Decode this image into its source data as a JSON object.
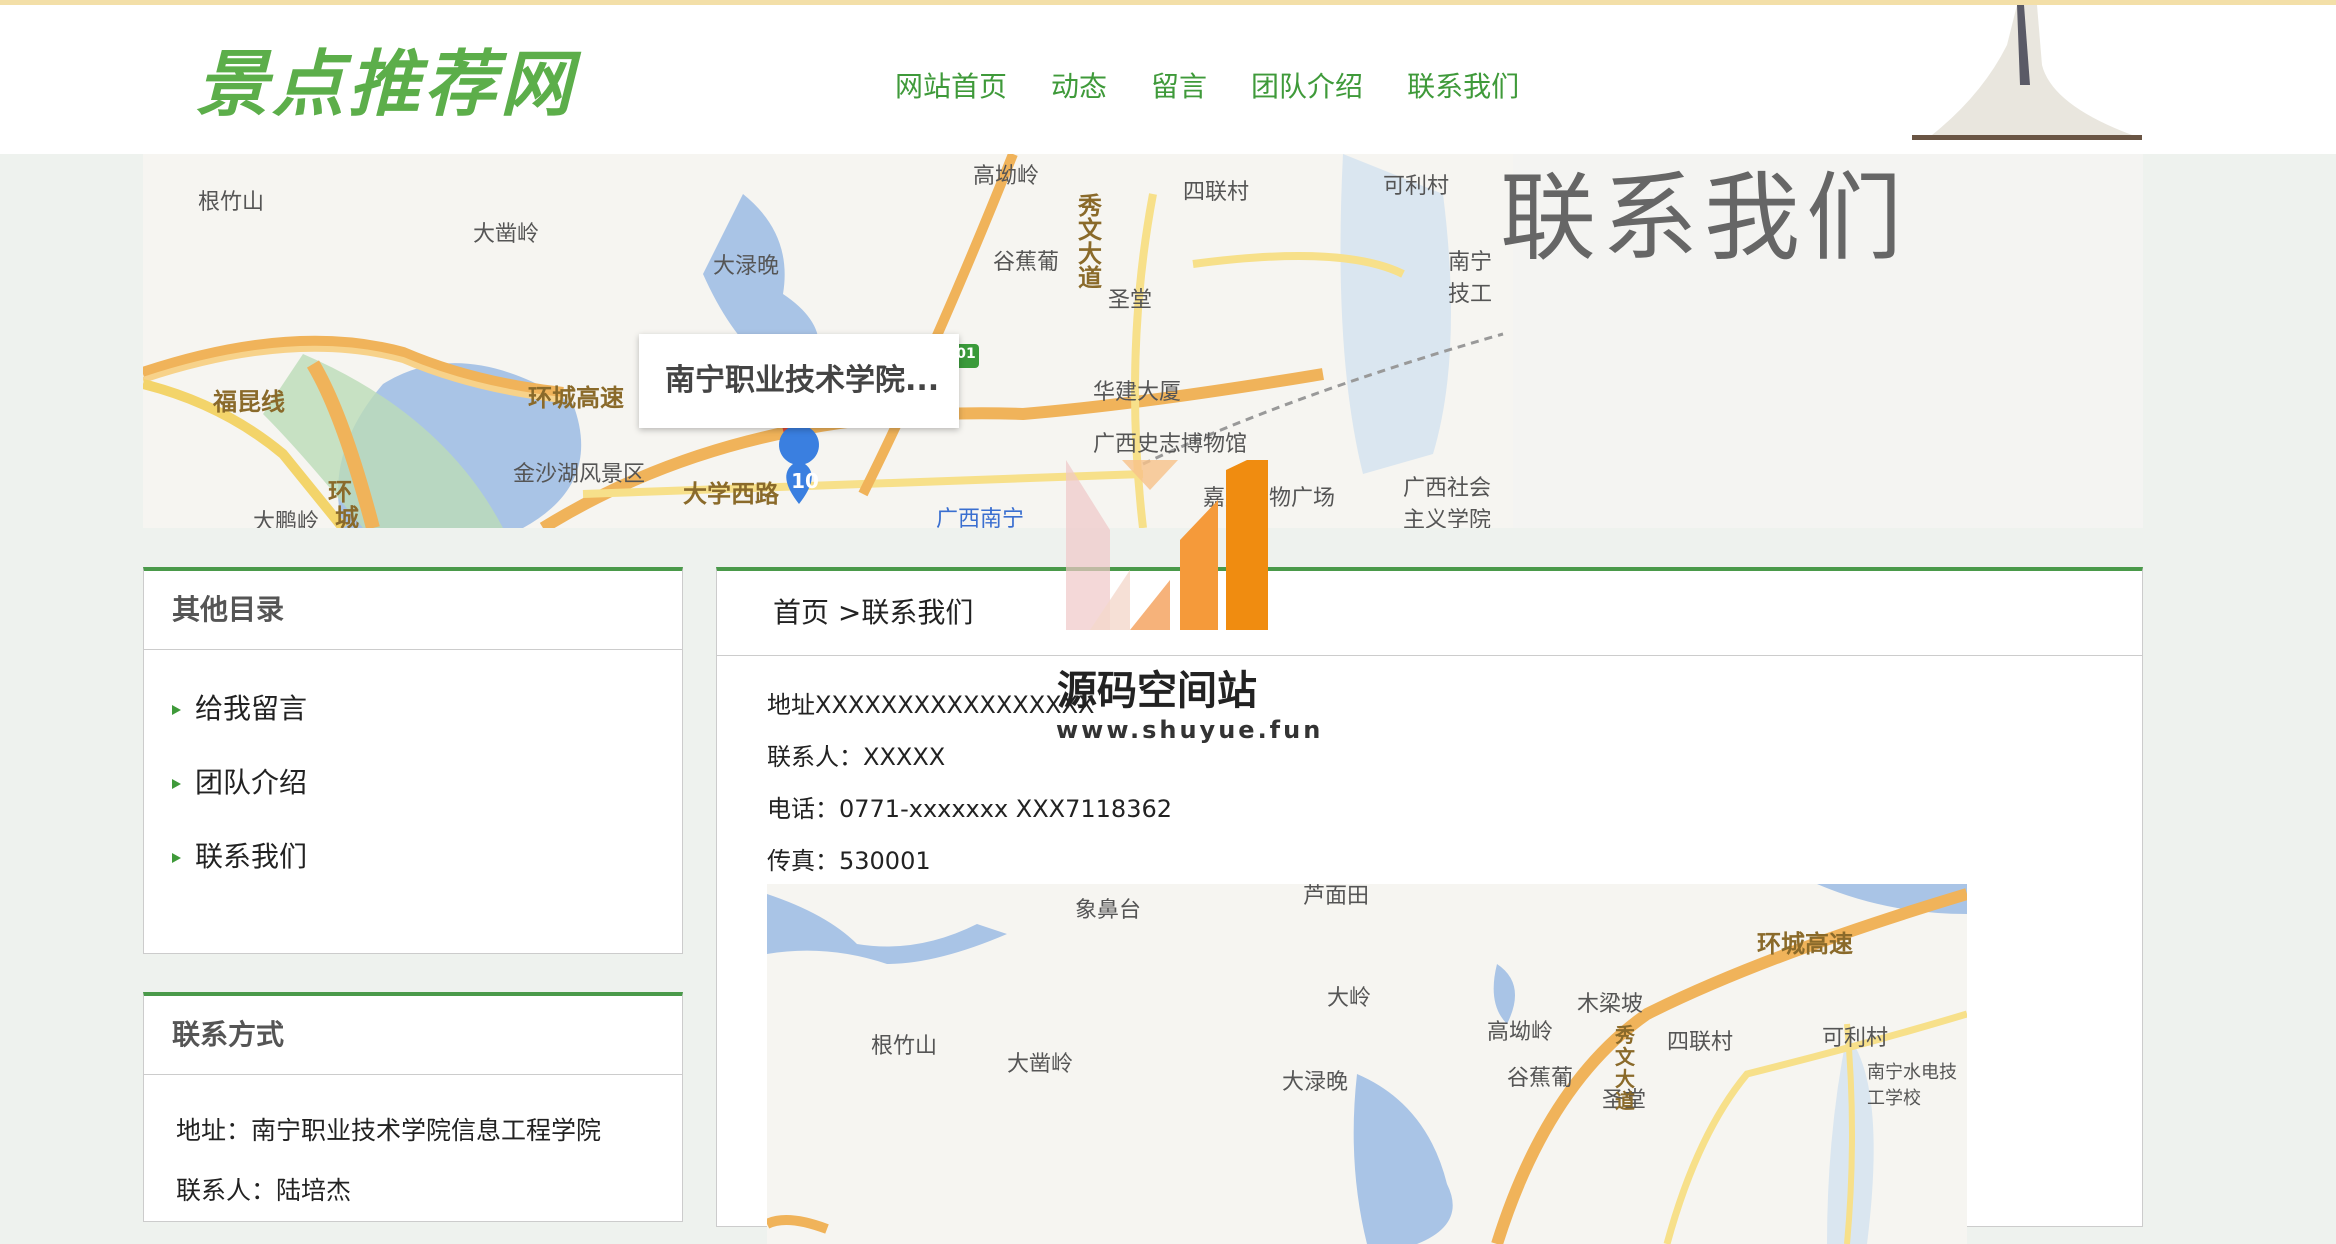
{
  "site": {
    "logo": "景点推荐网"
  },
  "nav": [
    "网站首页",
    "动态",
    "留言",
    "团队介绍",
    "联系我们"
  ],
  "banner": {
    "title": "联系我们",
    "popup": "南宁职业技术学院...",
    "marker_number": "10",
    "highway_badge": "01",
    "labels": [
      {
        "text": "根竹山"
      },
      {
        "text": "大凿岭"
      },
      {
        "text": "高坳岭"
      },
      {
        "text": "四联村"
      },
      {
        "text": "可利村"
      },
      {
        "text": "大渌晚"
      },
      {
        "text": "谷蕉葡"
      },
      {
        "text": "圣堂"
      },
      {
        "text": "华建大厦"
      },
      {
        "text": "广西史志博物馆"
      },
      {
        "text": "金沙湖风景区"
      },
      {
        "text": "大鹏岭"
      },
      {
        "text": "广西南宁"
      },
      {
        "text": "嘉茂购物广场"
      },
      {
        "text": "广西社会主义学院"
      },
      {
        "text": "南宁技工"
      }
    ],
    "roads": [
      {
        "text": "福昆线"
      },
      {
        "text": "环城高速"
      },
      {
        "text": "大学西路"
      },
      {
        "text": "环"
      },
      {
        "text": "城"
      },
      {
        "text": "秀文大道"
      }
    ]
  },
  "watermark": {
    "name": "源码空间站",
    "url": "www.shuyue.fun"
  },
  "sidebar": {
    "other_title": "其他目录",
    "items": [
      "给我留言",
      "团队介绍",
      "联系我们"
    ],
    "contact_title": "联系方式",
    "contact": [
      "地址：南宁职业技术学院信息工程学院",
      "联系人：陆培杰"
    ]
  },
  "main": {
    "breadcrumb": "首页 >联系我们",
    "address": "地址XXXXXXXXXXXXXXXXX",
    "contact": "联系人：XXXXX",
    "phone": "电话：0771-xxxxxxx  XXX7118362",
    "fax": "传真：530001",
    "map_labels": [
      {
        "text": "象鼻台"
      },
      {
        "text": "芦面田"
      },
      {
        "text": "环城高速"
      },
      {
        "text": "木梁坡"
      },
      {
        "text": "大岭"
      },
      {
        "text": "高坳岭"
      },
      {
        "text": "四联村"
      },
      {
        "text": "可利村"
      },
      {
        "text": "根竹山"
      },
      {
        "text": "大凿岭"
      },
      {
        "text": "大渌晚"
      },
      {
        "text": "谷蕉葡"
      },
      {
        "text": "圣堂"
      },
      {
        "text": "南宁水电技工学校"
      },
      {
        "text": "秀文大道"
      }
    ]
  },
  "colors": {
    "accent": "#3f9a3a",
    "border_top": "#4a9a4a",
    "logo": "#5cae4a"
  }
}
